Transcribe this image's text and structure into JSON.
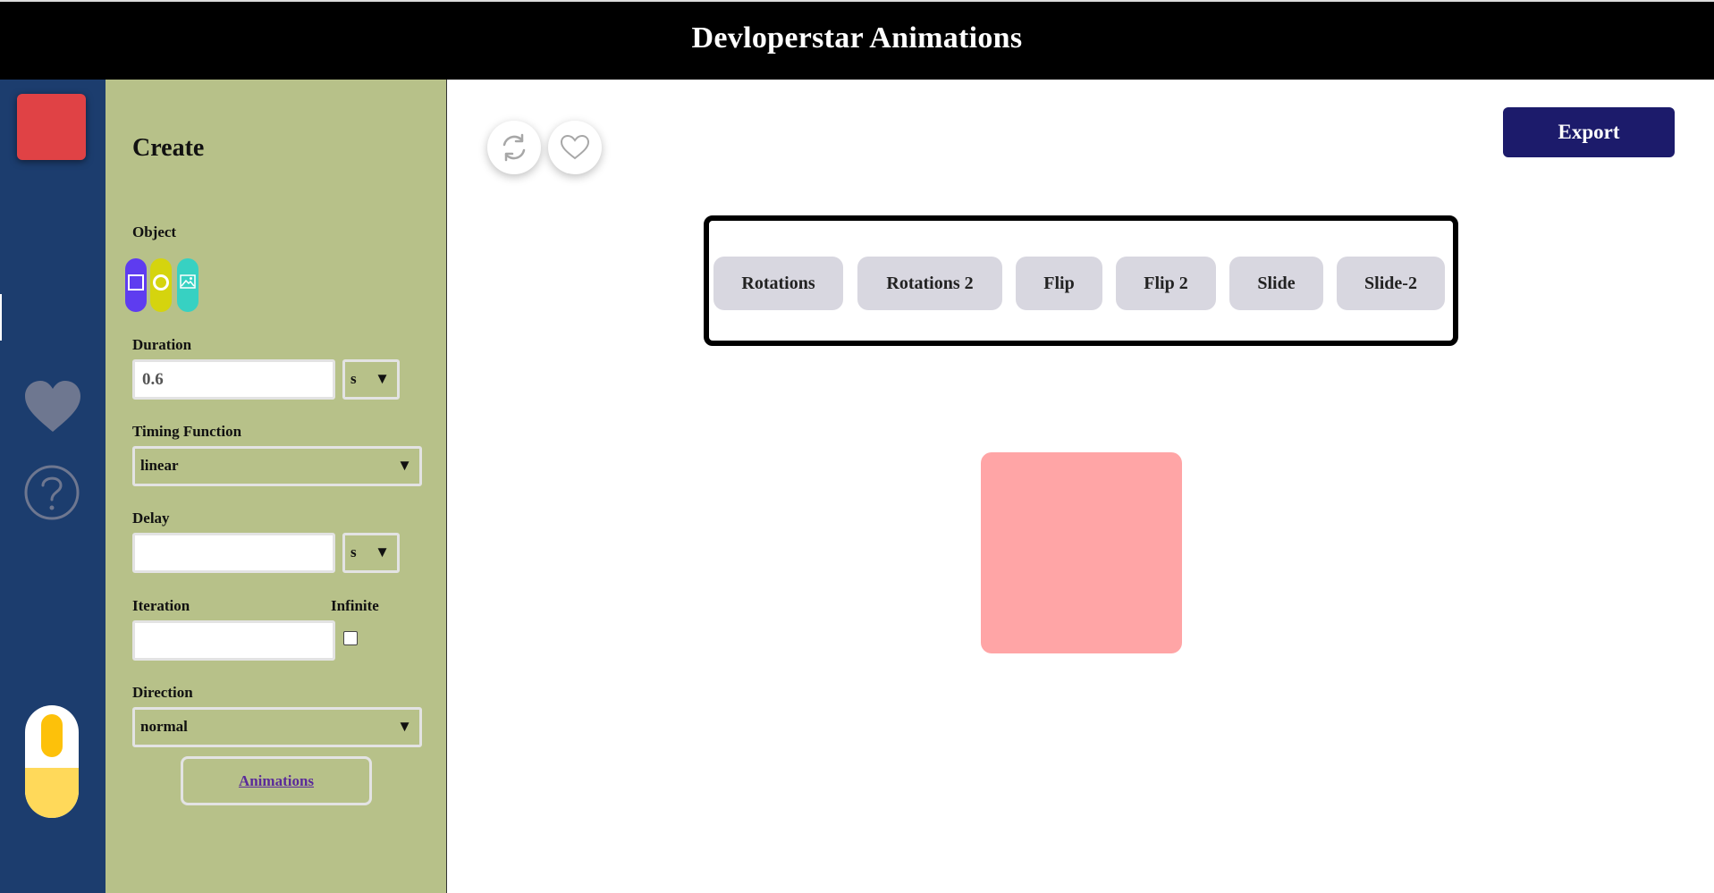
{
  "header": {
    "title": "Devloperstar Animations"
  },
  "sidebar": {
    "logo_color": "#e04245",
    "icons": [
      "heart-icon",
      "help-icon"
    ],
    "theme_toggle": "light"
  },
  "panel": {
    "title": "Create",
    "object": {
      "label": "Object",
      "options": [
        {
          "name": "square",
          "color": "#5e3cf0"
        },
        {
          "name": "circle",
          "color": "#d5d40e"
        },
        {
          "name": "image",
          "color": "#37d1c2"
        }
      ]
    },
    "duration": {
      "label": "Duration",
      "value": "0.6",
      "unit": "s"
    },
    "timing": {
      "label": "Timing Function",
      "value": "linear"
    },
    "delay": {
      "label": "Delay",
      "value": "",
      "unit": "s"
    },
    "iteration": {
      "label": "Iteration",
      "value": "",
      "infinite_label": "Infinite",
      "infinite_checked": false
    },
    "direction": {
      "label": "Direction",
      "value": "normal"
    },
    "animations_link": "Animations"
  },
  "toolbar": {
    "export_label": "Export",
    "export_color": "#1c1b6b",
    "icons": [
      "refresh-icon",
      "heart-outline-icon"
    ]
  },
  "presets": [
    "Rotations",
    "Rotations 2",
    "Flip",
    "Flip 2",
    "Slide",
    "Slide-2"
  ],
  "preview": {
    "color": "#ffa5a6"
  },
  "arrow_glyph": "▼"
}
